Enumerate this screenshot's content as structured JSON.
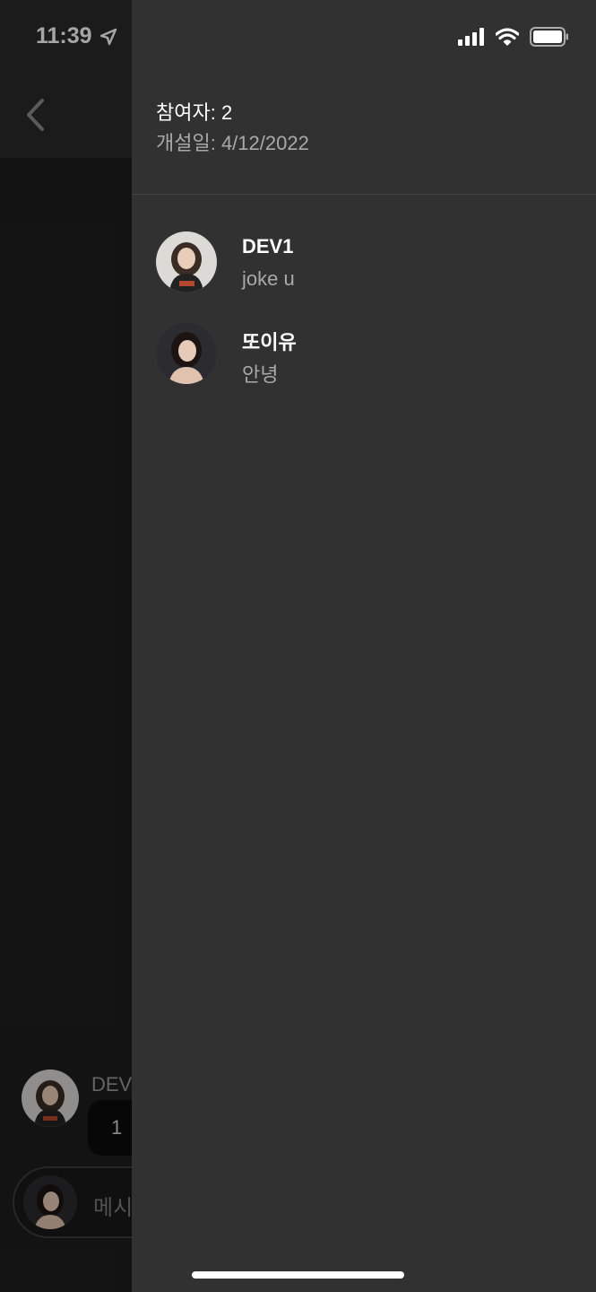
{
  "status_bar": {
    "time": "11:39",
    "location_icon": "location-arrow-icon",
    "signal_icon": "cellular-signal-icon",
    "wifi_icon": "wifi-icon",
    "battery_icon": "battery-icon"
  },
  "chat": {
    "back_icon": "chevron-left-icon",
    "sender_label": "DEV",
    "bubble_text": "1",
    "input_placeholder": "메시"
  },
  "drawer": {
    "participants_label": "참여자: 2",
    "created_label": "개설일: 4/12/2022",
    "participants": [
      {
        "name": "DEV1",
        "status": "joke u"
      },
      {
        "name": "또이유",
        "status": "안녕"
      }
    ]
  },
  "colors": {
    "drawer_bg": "#313131",
    "screen_bg": "#1e1e1e",
    "primary_text": "#ffffff",
    "secondary_text": "#a9a9a9"
  }
}
